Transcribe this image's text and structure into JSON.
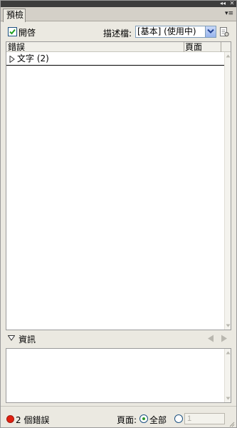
{
  "window": {
    "collapse_glyph": "◂◂",
    "close_glyph": "✕"
  },
  "tab": {
    "label": "預檢"
  },
  "panel_menu": {
    "glyph": "▾≡"
  },
  "options": {
    "on_label": "開啓",
    "on_checked": true,
    "profile_label": "描述檔:",
    "profile_value": "[基本] (使用中)"
  },
  "errors": {
    "columns": [
      "錯誤",
      "頁面"
    ],
    "rows": [
      {
        "label": "文字 (2)",
        "page": ""
      }
    ]
  },
  "info": {
    "label": "資訊"
  },
  "status": {
    "error_count_text": "2 個錯誤",
    "pages_label": "頁面:",
    "all_label": "全部",
    "range_value": "1",
    "all_selected": true
  },
  "colors": {
    "error_dot": "#e02010",
    "radio_selected": "#2a9a2a",
    "checkbox_border": "#1c5180"
  }
}
